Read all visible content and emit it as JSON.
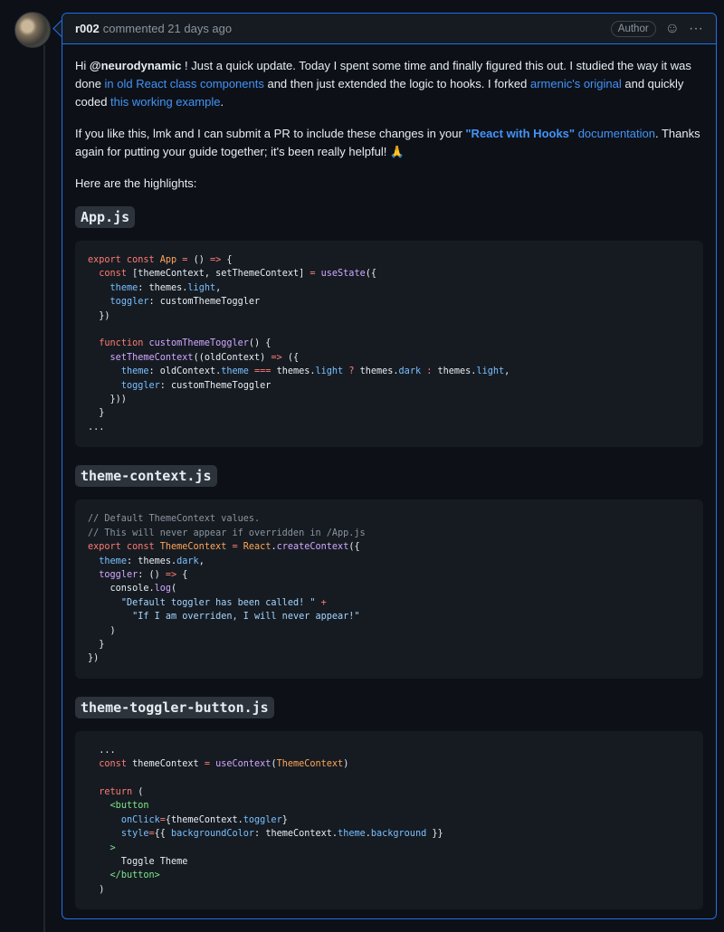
{
  "comment": {
    "author": "r002",
    "meta": "commented 21 days ago",
    "badge": "Author",
    "para1": {
      "t1": "Hi ",
      "mention": "@neurodynamic",
      "t2": " ! Just a quick update. Today I spent some time and finally figured this out. I studied the way it was done ",
      "link1": "in old React class components",
      "t3": " and then just extended the logic to hooks. I forked ",
      "link2": "armenic's original",
      "t4": " and quickly coded ",
      "link3": "this working example",
      "t5": "."
    },
    "para2": {
      "t1": "If you like this, lmk and I can submit a PR to include these changes in your ",
      "link_bold": "\"React with Hooks\"",
      "link_rest": " documentation",
      "t2": ". Thanks again for putting your guide together; it's been really helpful! 🙏"
    },
    "para3": "Here are the highlights:",
    "files": [
      {
        "name": "App.js"
      },
      {
        "name": "theme-context.js"
      },
      {
        "name": "theme-toggler-button.js"
      }
    ]
  },
  "icons": [
    "smiley-icon",
    "kebab-menu-icon"
  ]
}
